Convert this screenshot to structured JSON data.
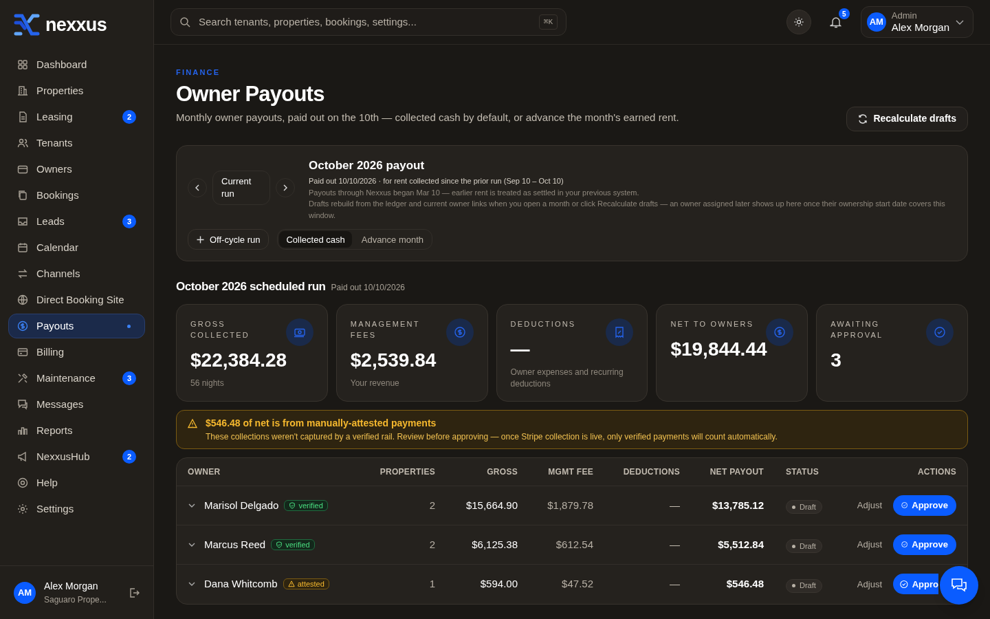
{
  "brand": "nexxus",
  "sidebar": {
    "items": [
      {
        "label": "Dashboard",
        "selected": false
      },
      {
        "label": "Properties",
        "selected": false
      },
      {
        "label": "Leasing",
        "badge": "2",
        "selected": false
      },
      {
        "label": "Tenants",
        "selected": false
      },
      {
        "label": "Owners",
        "selected": false
      },
      {
        "label": "Bookings",
        "selected": false
      },
      {
        "label": "Leads",
        "badge": "3",
        "selected": false
      },
      {
        "label": "Calendar",
        "selected": false
      },
      {
        "label": "Channels",
        "selected": false
      },
      {
        "label": "Direct Booking Site",
        "selected": false
      },
      {
        "label": "Payouts",
        "selected": true
      },
      {
        "label": "Billing",
        "selected": false
      },
      {
        "label": "Maintenance",
        "badge": "3",
        "selected": false
      },
      {
        "label": "Messages",
        "selected": false
      },
      {
        "label": "Reports",
        "selected": false
      },
      {
        "label": "NexxusHub",
        "badge": "2",
        "selected": false
      },
      {
        "label": "Help",
        "selected": false
      },
      {
        "label": "Settings",
        "selected": false
      }
    ],
    "user": {
      "initials": "AM",
      "name": "Alex Morgan",
      "org": "Saguaro Prope..."
    }
  },
  "topbar": {
    "search_placeholder": "Search tenants, properties, bookings, settings...",
    "shortcut": "⌘K",
    "notifications": "5",
    "user": {
      "initials": "AM",
      "role": "Admin",
      "name": "Alex Morgan"
    }
  },
  "header": {
    "eyebrow": "FINANCE",
    "title": "Owner Payouts",
    "subtitle": "Monthly owner payouts, paid out on the 10th — collected cash by default, or advance the month's earned rent.",
    "action": "Recalculate drafts"
  },
  "period": {
    "nav_label": "Current run",
    "title": "October 2026 payout",
    "lines": [
      "Paid out 10/10/2026 · for rent collected since the prior run (Sep 10 – Oct 10)",
      "Payouts through Nexxus began Mar 10 — earlier rent is treated as settled in your previous system.",
      "Drafts rebuild from the ledger and current owner links when you open a month or click Recalculate drafts — an owner assigned later shows up here once their ownership start date covers this window."
    ],
    "offcycle": "Off-cycle run",
    "modes": [
      {
        "label": "Collected cash",
        "selected": true
      },
      {
        "label": "Advance month",
        "selected": false
      }
    ]
  },
  "run": {
    "title": "October 2026 scheduled run",
    "subtitle": "Paid out 10/10/2026"
  },
  "stats": [
    {
      "label": "GROSS COLLECTED",
      "value": "$22,384.28",
      "note": "56 nights"
    },
    {
      "label": "MANAGEMENT FEES",
      "value": "$2,539.84",
      "note": "Your revenue"
    },
    {
      "label": "DEDUCTIONS",
      "value": "—",
      "note": "Owner expenses and recurring deductions"
    },
    {
      "label": "NET TO OWNERS",
      "value": "$19,844.44"
    },
    {
      "label": "AWAITING APPROVAL",
      "value": "3"
    }
  ],
  "alert": {
    "title": "$546.48 of net is from manually-attested payments",
    "text": "These collections weren't captured by a verified rail. Review before approving — once Stripe collection is live, only verified payments will count automatically."
  },
  "table": {
    "columns": [
      "OWNER",
      "PROPERTIES",
      "GROSS",
      "MGMT FEE",
      "DEDUCTIONS",
      "NET PAYOUT",
      "STATUS",
      "ACTIONS"
    ],
    "rows": [
      {
        "owner": "Marisol Delgado",
        "tag": {
          "kind": "verified",
          "label": "verified"
        },
        "properties": "2",
        "gross": "$15,664.90",
        "fee": "$1,879.78",
        "deductions": "—",
        "net": "$13,785.12",
        "status": "Draft",
        "adjust": "Adjust",
        "approve": "Approve"
      },
      {
        "owner": "Marcus Reed",
        "tag": {
          "kind": "verified",
          "label": "verified"
        },
        "properties": "2",
        "gross": "$6,125.38",
        "fee": "$612.54",
        "deductions": "—",
        "net": "$5,512.84",
        "status": "Draft",
        "adjust": "Adjust",
        "approve": "Approve"
      },
      {
        "owner": "Dana Whitcomb",
        "tag": {
          "kind": "attested",
          "label": "attested"
        },
        "properties": "1",
        "gross": "$594.00",
        "fee": "$47.52",
        "deductions": "—",
        "net": "$546.48",
        "status": "Draft",
        "adjust": "Adjust",
        "approve": "Appro",
        "approve_covered": true
      }
    ]
  }
}
